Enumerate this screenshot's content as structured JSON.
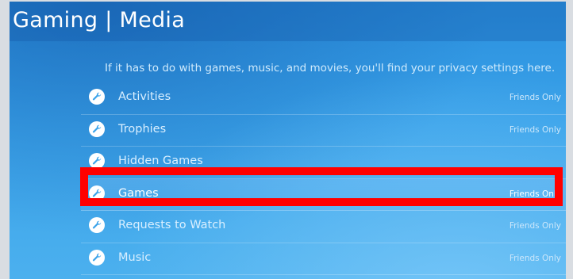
{
  "header": {
    "title": "Gaming | Media"
  },
  "description": "If it has to do with games, music, and movies, you'll find your privacy settings here.",
  "settings": [
    {
      "label": "Activities",
      "value": "Friends Only",
      "icon": "wrench-icon"
    },
    {
      "label": "Trophies",
      "value": "Friends Only",
      "icon": "wrench-icon"
    },
    {
      "label": "Hidden Games",
      "value": "",
      "icon": "wrench-icon"
    },
    {
      "label": "Games",
      "value": "Friends Only",
      "icon": "wrench-icon",
      "selected": true
    },
    {
      "label": "Requests to Watch",
      "value": "Friends Only",
      "icon": "wrench-icon"
    },
    {
      "label": "Music",
      "value": "Friends Only",
      "icon": "wrench-icon"
    }
  ],
  "colors": {
    "highlight": "#ff0000",
    "background": "#3aa3ea"
  }
}
